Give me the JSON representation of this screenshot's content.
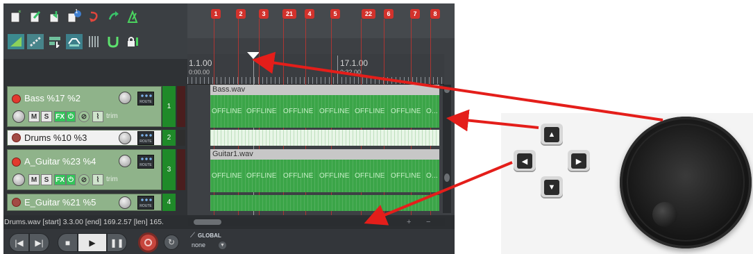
{
  "toolbar": {
    "row1_icons": [
      "new-project-icon",
      "open-project-icon",
      "save-project-icon",
      "project-settings-icon",
      "undo-icon",
      "redo-icon",
      "metronome-icon"
    ],
    "row2_icons": [
      "auto-crossfade-icon",
      "ripple-edit-icon",
      "grid-snap-icon",
      "envelope-icon",
      "grid-icon",
      "snap-magnet-icon",
      "lock-icon"
    ],
    "project_badge": "1"
  },
  "markers": [
    "1",
    "2",
    "3",
    "21",
    "4",
    "5",
    "22",
    "6",
    "7",
    "8"
  ],
  "ruler": {
    "left_bar": "1.1.00",
    "left_time": "0:00.00",
    "right_bar": "17.1.00",
    "right_time": "0:32.00"
  },
  "tracks": [
    {
      "name": "Bass %17 %2",
      "number": "1",
      "mute": "M",
      "solo": "S",
      "fx": "FX",
      "trim": "trim",
      "route": "ROUTE"
    },
    {
      "name": "Drums %10 %3",
      "number": "2",
      "route": "ROUTE"
    },
    {
      "name": "A_Guitar %23 %4",
      "number": "3",
      "mute": "M",
      "solo": "S",
      "fx": "FX",
      "trim": "trim",
      "route": "ROUTE"
    },
    {
      "name": "E_Guitar %21 %5",
      "number": "4",
      "route": "ROUTE"
    }
  ],
  "items": {
    "bass_file": "Bass.wav",
    "guitar_file": "Guitar1.wav",
    "offline_text": "OFFLINE",
    "offline_truncated": "O..."
  },
  "status_line": "Drums.wav [start] 3.3.00 [end] 169.2.57 [len] 165.",
  "automation": {
    "mode_label": "GLOBAL",
    "mode_value": "none"
  },
  "controller_labels": {
    "dpad": [
      "up-arrow-key",
      "left-arrow-key",
      "right-arrow-key",
      "down-arrow-key"
    ],
    "knob": "jog-wheel"
  },
  "colors": {
    "record_red": "#e23a2e",
    "track_green": "#1f8a29",
    "item_green": "#3ba548",
    "annotation_arrow": "#e41e1a"
  }
}
